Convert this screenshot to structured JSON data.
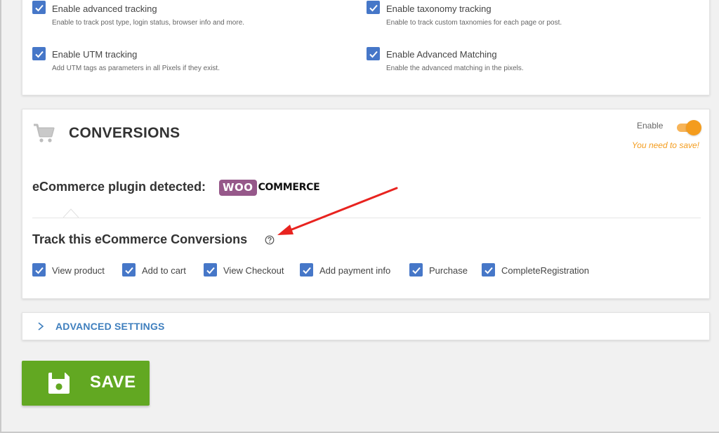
{
  "tracking": {
    "options": [
      {
        "label": "Enable advanced tracking",
        "desc": "Enable to track post type, login status, browser info and more.",
        "checked": true
      },
      {
        "label": "Enable taxonomy tracking",
        "desc": "Enable to track custom taxnomies for each page or post.",
        "checked": true
      },
      {
        "label": "Enable UTM tracking",
        "desc": "Add UTM tags as parameters in all Pixels if they exist.",
        "checked": true
      },
      {
        "label": "Enable Advanced Matching",
        "desc": "Enable the advanced matching in the pixels.",
        "checked": true
      }
    ]
  },
  "conversions": {
    "title": "CONVERSIONS",
    "enable_label": "Enable",
    "enabled": true,
    "save_notice": "You need to save!",
    "plugin_detected_label": "eCommerce plugin detected:",
    "plugin_logo": {
      "badge": "WOO",
      "text": "COMMERCE"
    },
    "track_title": "Track this eCommerce Conversions",
    "events": [
      {
        "label": "View product",
        "checked": true
      },
      {
        "label": "Add to cart",
        "checked": true
      },
      {
        "label": "View Checkout",
        "checked": true
      },
      {
        "label": "Add payment info",
        "checked": true
      },
      {
        "label": "Purchase",
        "checked": true
      },
      {
        "label": "CompleteRegistration",
        "checked": true
      }
    ]
  },
  "advanced": {
    "label": "ADVANCED SETTINGS"
  },
  "save_button": {
    "label": "SAVE"
  },
  "colors": {
    "checkbox": "#4677c8",
    "toggle_on": "#f49c1d",
    "save_button": "#62a822",
    "link_blue": "#3f7fbe",
    "woo_purple": "#96588a",
    "annotation_arrow": "#e8231f"
  },
  "icons": [
    "cart-icon",
    "question-mark-icon",
    "chevron-right-icon",
    "floppy-disk-icon",
    "checkmark-icon"
  ]
}
